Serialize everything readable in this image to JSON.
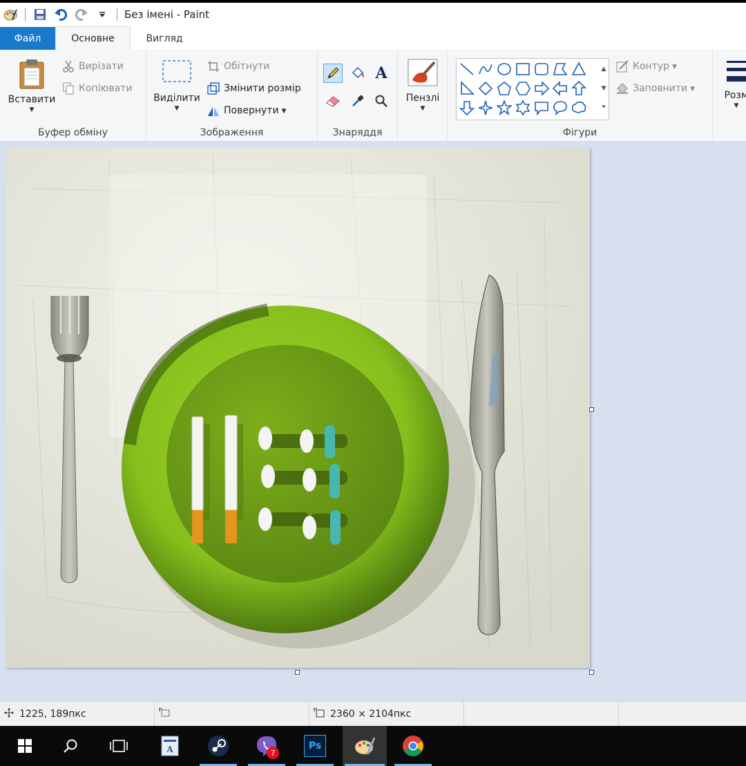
{
  "window": {
    "title": "Без імені - Paint"
  },
  "quick_access": {
    "icons": [
      "paint-app-icon",
      "save-icon",
      "undo-icon",
      "redo-icon",
      "customize-dropdown-icon"
    ]
  },
  "tabs": [
    {
      "label": "Файл"
    },
    {
      "label": "Основне"
    },
    {
      "label": "Вигляд"
    }
  ],
  "ribbon": {
    "clipboard": {
      "paste_label": "Вставити",
      "cut_label": "Вирізати",
      "copy_label": "Копіювати",
      "group_label": "Буфер обміну"
    },
    "image": {
      "select_label": "Виділити",
      "crop_label": "Обітнути",
      "resize_label": "Змінити розмір",
      "rotate_label": "Повернути",
      "group_label": "Зображення"
    },
    "tools": {
      "group_label": "Знаряддя",
      "items": [
        "pencil-icon",
        "fill-icon",
        "text-icon",
        "eraser-icon",
        "color-picker-icon",
        "magnifier-icon"
      ]
    },
    "brushes": {
      "label": "Пензлі"
    },
    "shapes": {
      "group_label": "Фігури",
      "outline_label": "Контур",
      "fill_label": "Заповнити"
    },
    "size": {
      "label": "Розм"
    }
  },
  "status": {
    "cursor_pos": "1225, 189пкс",
    "selection": "",
    "image_size": "2360 × 2104пкс"
  },
  "taskbar": {
    "items": [
      "windows-start-icon",
      "search-icon",
      "task-view-icon",
      "word-icon",
      "steam-icon",
      "viber-icon",
      "photoshop-icon",
      "paint-icon",
      "chrome-icon"
    ],
    "viber_badge": "7",
    "photoshop_label": "Ps"
  },
  "colors": {
    "accent": "#1979ca",
    "workspace": "#d6e0ee",
    "plate": "#8cc51e"
  }
}
